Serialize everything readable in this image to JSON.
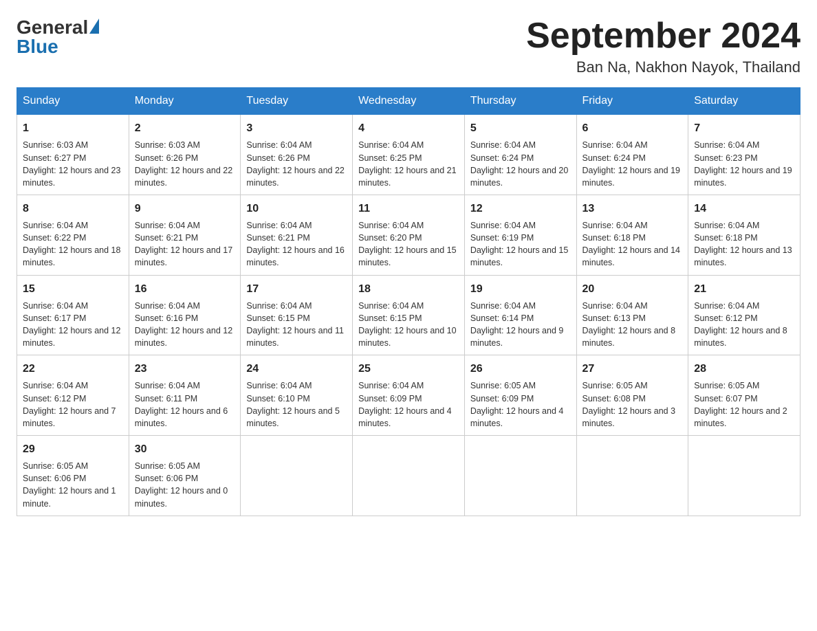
{
  "header": {
    "logo_general": "General",
    "logo_blue": "Blue",
    "month_title": "September 2024",
    "location": "Ban Na, Nakhon Nayok, Thailand"
  },
  "weekdays": [
    "Sunday",
    "Monday",
    "Tuesday",
    "Wednesday",
    "Thursday",
    "Friday",
    "Saturday"
  ],
  "weeks": [
    [
      {
        "day": "1",
        "sunrise": "6:03 AM",
        "sunset": "6:27 PM",
        "daylight": "12 hours and 23 minutes."
      },
      {
        "day": "2",
        "sunrise": "6:03 AM",
        "sunset": "6:26 PM",
        "daylight": "12 hours and 22 minutes."
      },
      {
        "day": "3",
        "sunrise": "6:04 AM",
        "sunset": "6:26 PM",
        "daylight": "12 hours and 22 minutes."
      },
      {
        "day": "4",
        "sunrise": "6:04 AM",
        "sunset": "6:25 PM",
        "daylight": "12 hours and 21 minutes."
      },
      {
        "day": "5",
        "sunrise": "6:04 AM",
        "sunset": "6:24 PM",
        "daylight": "12 hours and 20 minutes."
      },
      {
        "day": "6",
        "sunrise": "6:04 AM",
        "sunset": "6:24 PM",
        "daylight": "12 hours and 19 minutes."
      },
      {
        "day": "7",
        "sunrise": "6:04 AM",
        "sunset": "6:23 PM",
        "daylight": "12 hours and 19 minutes."
      }
    ],
    [
      {
        "day": "8",
        "sunrise": "6:04 AM",
        "sunset": "6:22 PM",
        "daylight": "12 hours and 18 minutes."
      },
      {
        "day": "9",
        "sunrise": "6:04 AM",
        "sunset": "6:21 PM",
        "daylight": "12 hours and 17 minutes."
      },
      {
        "day": "10",
        "sunrise": "6:04 AM",
        "sunset": "6:21 PM",
        "daylight": "12 hours and 16 minutes."
      },
      {
        "day": "11",
        "sunrise": "6:04 AM",
        "sunset": "6:20 PM",
        "daylight": "12 hours and 15 minutes."
      },
      {
        "day": "12",
        "sunrise": "6:04 AM",
        "sunset": "6:19 PM",
        "daylight": "12 hours and 15 minutes."
      },
      {
        "day": "13",
        "sunrise": "6:04 AM",
        "sunset": "6:18 PM",
        "daylight": "12 hours and 14 minutes."
      },
      {
        "day": "14",
        "sunrise": "6:04 AM",
        "sunset": "6:18 PM",
        "daylight": "12 hours and 13 minutes."
      }
    ],
    [
      {
        "day": "15",
        "sunrise": "6:04 AM",
        "sunset": "6:17 PM",
        "daylight": "12 hours and 12 minutes."
      },
      {
        "day": "16",
        "sunrise": "6:04 AM",
        "sunset": "6:16 PM",
        "daylight": "12 hours and 12 minutes."
      },
      {
        "day": "17",
        "sunrise": "6:04 AM",
        "sunset": "6:15 PM",
        "daylight": "12 hours and 11 minutes."
      },
      {
        "day": "18",
        "sunrise": "6:04 AM",
        "sunset": "6:15 PM",
        "daylight": "12 hours and 10 minutes."
      },
      {
        "day": "19",
        "sunrise": "6:04 AM",
        "sunset": "6:14 PM",
        "daylight": "12 hours and 9 minutes."
      },
      {
        "day": "20",
        "sunrise": "6:04 AM",
        "sunset": "6:13 PM",
        "daylight": "12 hours and 8 minutes."
      },
      {
        "day": "21",
        "sunrise": "6:04 AM",
        "sunset": "6:12 PM",
        "daylight": "12 hours and 8 minutes."
      }
    ],
    [
      {
        "day": "22",
        "sunrise": "6:04 AM",
        "sunset": "6:12 PM",
        "daylight": "12 hours and 7 minutes."
      },
      {
        "day": "23",
        "sunrise": "6:04 AM",
        "sunset": "6:11 PM",
        "daylight": "12 hours and 6 minutes."
      },
      {
        "day": "24",
        "sunrise": "6:04 AM",
        "sunset": "6:10 PM",
        "daylight": "12 hours and 5 minutes."
      },
      {
        "day": "25",
        "sunrise": "6:04 AM",
        "sunset": "6:09 PM",
        "daylight": "12 hours and 4 minutes."
      },
      {
        "day": "26",
        "sunrise": "6:05 AM",
        "sunset": "6:09 PM",
        "daylight": "12 hours and 4 minutes."
      },
      {
        "day": "27",
        "sunrise": "6:05 AM",
        "sunset": "6:08 PM",
        "daylight": "12 hours and 3 minutes."
      },
      {
        "day": "28",
        "sunrise": "6:05 AM",
        "sunset": "6:07 PM",
        "daylight": "12 hours and 2 minutes."
      }
    ],
    [
      {
        "day": "29",
        "sunrise": "6:05 AM",
        "sunset": "6:06 PM",
        "daylight": "12 hours and 1 minute."
      },
      {
        "day": "30",
        "sunrise": "6:05 AM",
        "sunset": "6:06 PM",
        "daylight": "12 hours and 0 minutes."
      },
      {
        "day": "",
        "sunrise": "",
        "sunset": "",
        "daylight": ""
      },
      {
        "day": "",
        "sunrise": "",
        "sunset": "",
        "daylight": ""
      },
      {
        "day": "",
        "sunrise": "",
        "sunset": "",
        "daylight": ""
      },
      {
        "day": "",
        "sunrise": "",
        "sunset": "",
        "daylight": ""
      },
      {
        "day": "",
        "sunrise": "",
        "sunset": "",
        "daylight": ""
      }
    ]
  ]
}
